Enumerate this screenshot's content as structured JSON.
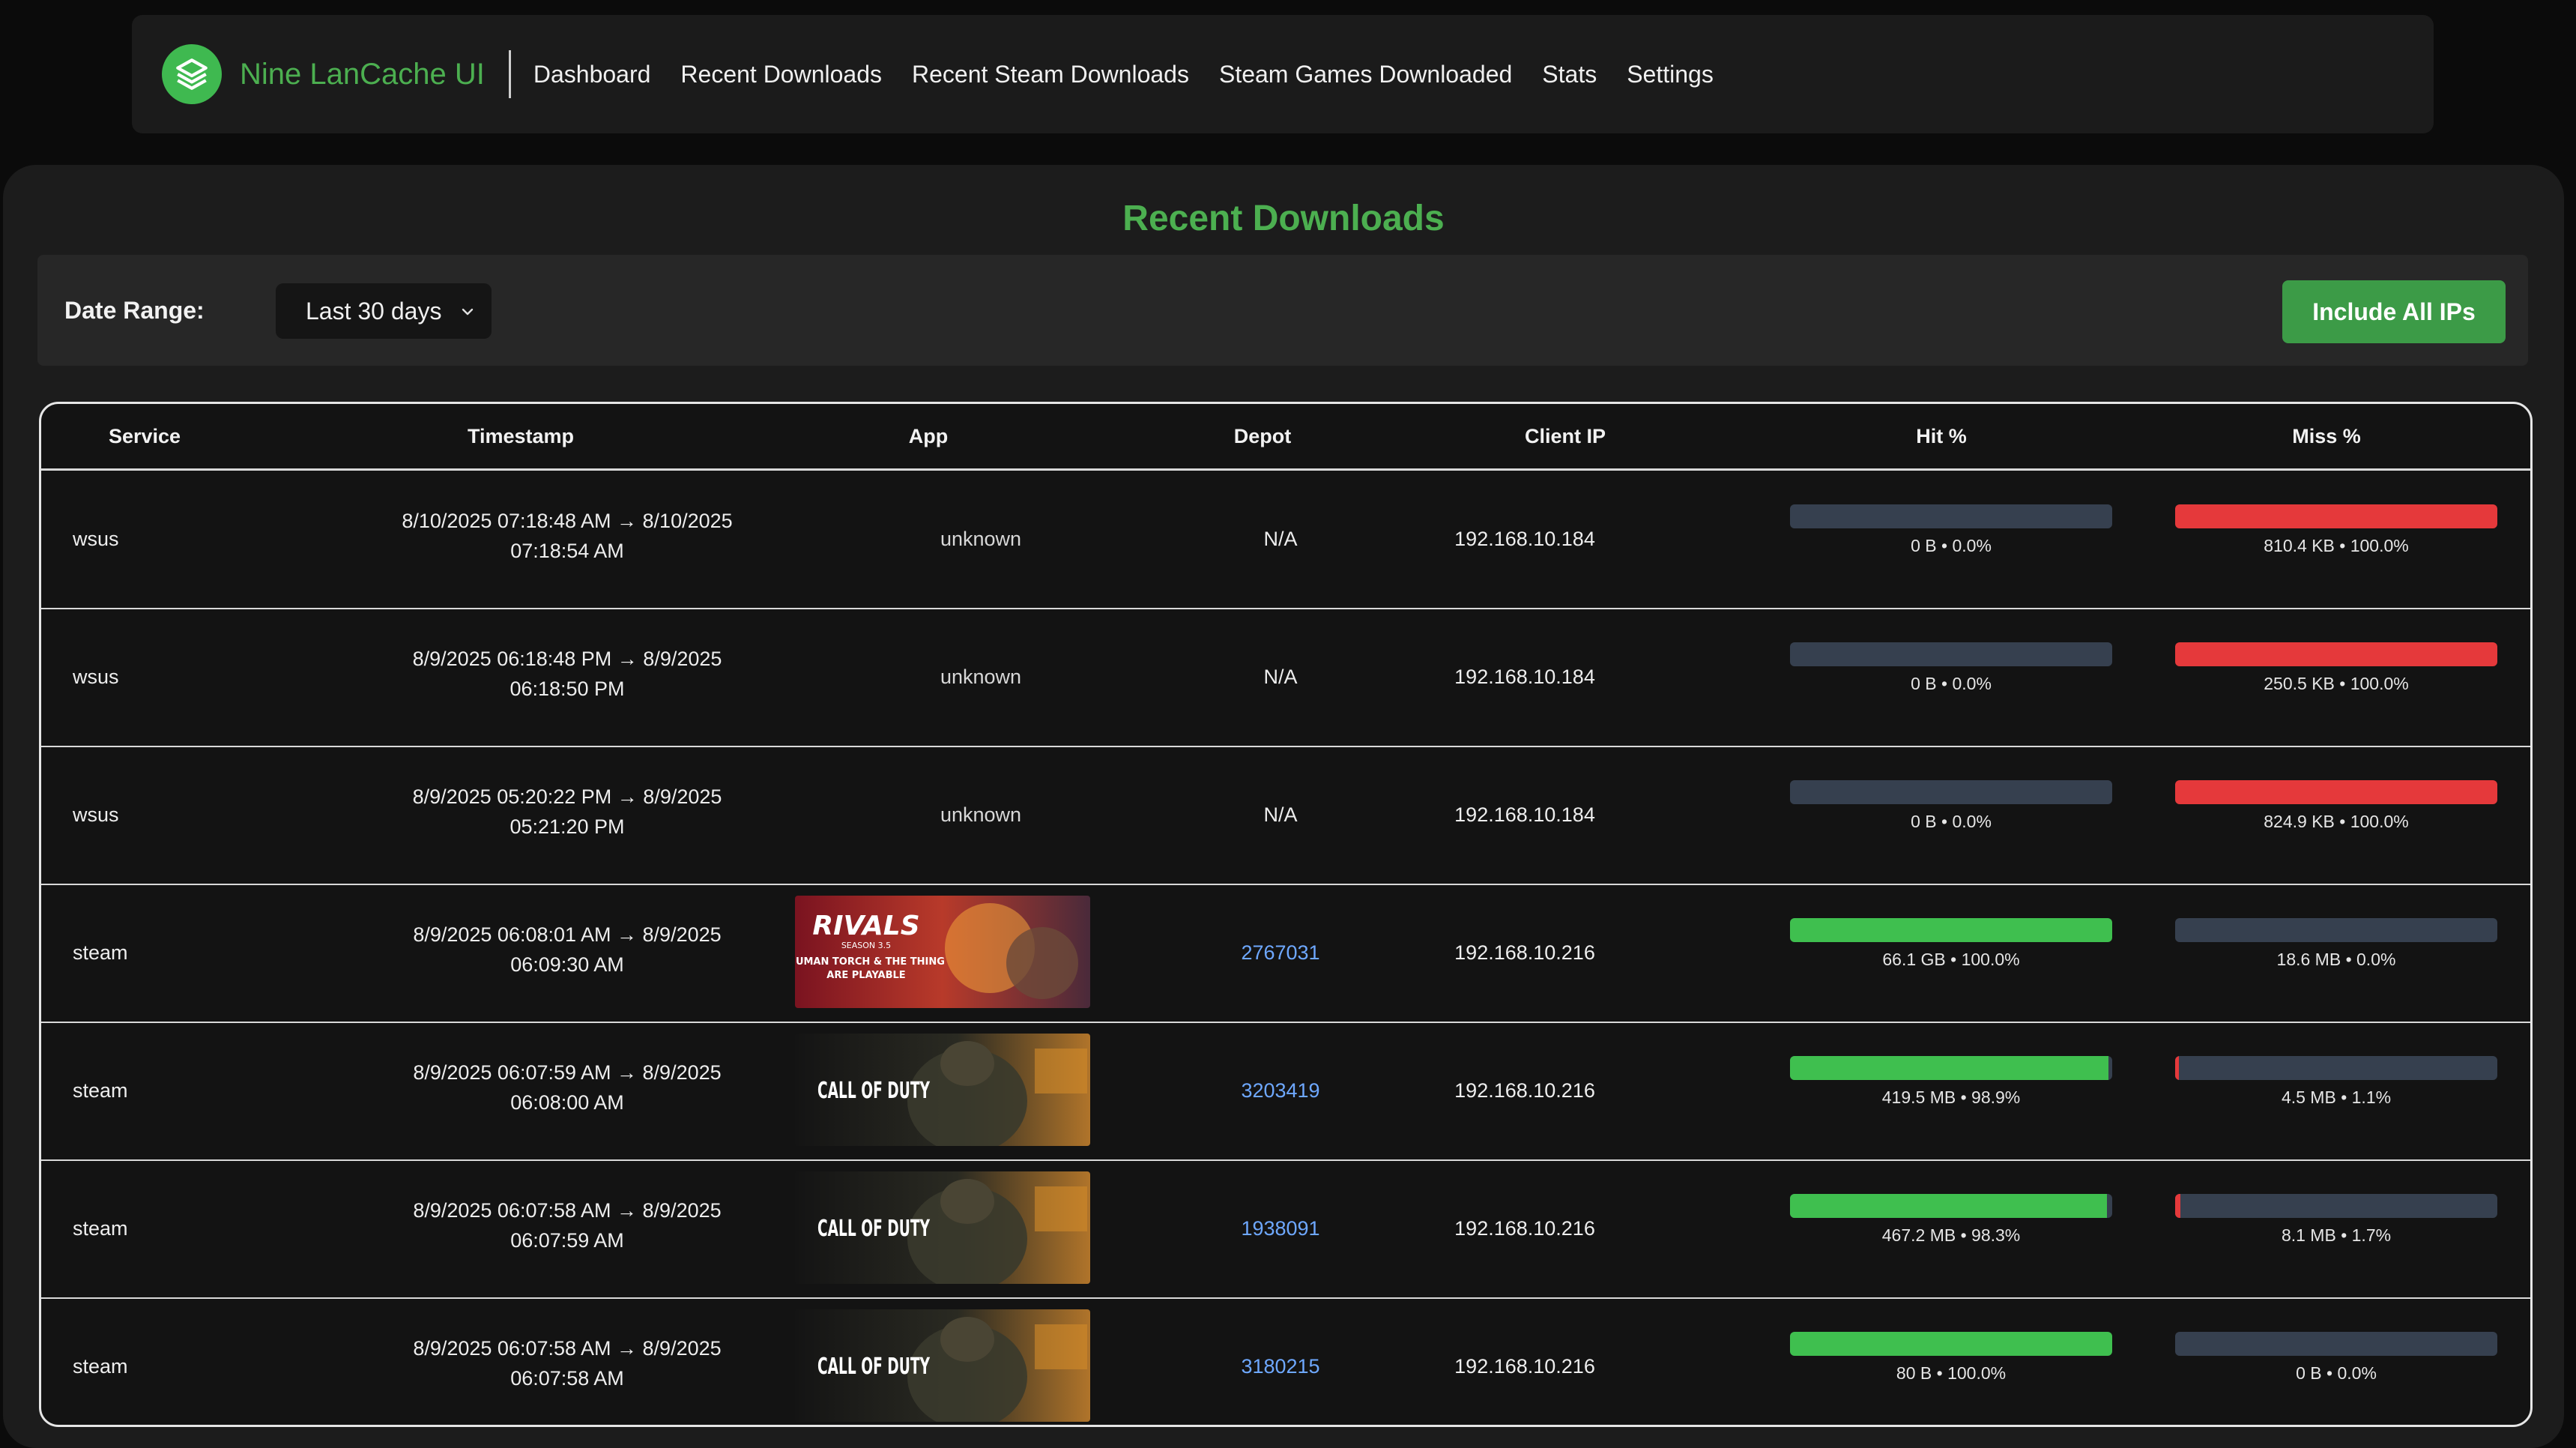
{
  "nav": {
    "brand": "Nine LanCache UI",
    "items": [
      "Dashboard",
      "Recent Downloads",
      "Recent Steam Downloads",
      "Steam Games Downloaded",
      "Stats",
      "Settings"
    ]
  },
  "page": {
    "title": "Recent Downloads",
    "date_range_label": "Date Range:",
    "date_range_value": "Last 30 days",
    "include_button": "Include All IPs"
  },
  "colors": {
    "accent": "#4caf50",
    "hit": "#3fbf4f",
    "miss": "#e5393b",
    "empty": "#36404f",
    "link": "#6ea8ff"
  },
  "table": {
    "headers": [
      "Service",
      "Timestamp",
      "App",
      "Depot",
      "Client IP",
      "Hit %",
      "Miss %"
    ],
    "rows": [
      {
        "service": "wsus",
        "ts1": "8/10/2025 07:18:48 AM → 8/10/2025",
        "ts2": "07:18:54 AM",
        "app": "unknown",
        "depot": "N/A",
        "ip": "192.168.10.184",
        "hit_label": "0 B • 0.0%",
        "hit_pct": 0.0,
        "miss_label": "810.4 KB • 100.0%",
        "miss_pct": 100.0
      },
      {
        "service": "wsus",
        "ts1": "8/9/2025 06:18:48 PM → 8/9/2025",
        "ts2": "06:18:50 PM",
        "app": "unknown",
        "depot": "N/A",
        "ip": "192.168.10.184",
        "hit_label": "0 B • 0.0%",
        "hit_pct": 0.0,
        "miss_label": "250.5 KB • 100.0%",
        "miss_pct": 100.0
      },
      {
        "service": "wsus",
        "ts1": "8/9/2025 05:20:22 PM → 8/9/2025",
        "ts2": "05:21:20 PM",
        "app": "unknown",
        "depot": "N/A",
        "ip": "192.168.10.184",
        "hit_label": "0 B • 0.0%",
        "hit_pct": 0.0,
        "miss_label": "824.9 KB • 100.0%",
        "miss_pct": 100.0
      },
      {
        "service": "steam",
        "ts1": "8/9/2025 06:08:01 AM → 8/9/2025",
        "ts2": "06:09:30 AM",
        "app_image": "rivals",
        "img_line1": "RIVALS",
        "img_line2": "SEASON 3.5",
        "img_line3": "HUMAN TORCH & THE THING",
        "img_line4": "ARE PLAYABLE",
        "depot": "2767031",
        "ip": "192.168.10.216",
        "hit_label": "66.1 GB • 100.0%",
        "hit_pct": 100.0,
        "miss_label": "18.6 MB • 0.0%",
        "miss_pct": 0.0
      },
      {
        "service": "steam",
        "ts1": "8/9/2025 06:07:59 AM → 8/9/2025",
        "ts2": "06:08:00 AM",
        "app_image": "cod",
        "img_line1": "CALL OF DUTY",
        "depot": "3203419",
        "ip": "192.168.10.216",
        "hit_label": "419.5 MB • 98.9%",
        "hit_pct": 98.9,
        "miss_label": "4.5 MB • 1.1%",
        "miss_pct": 1.1
      },
      {
        "service": "steam",
        "ts1": "8/9/2025 06:07:58 AM → 8/9/2025",
        "ts2": "06:07:59 AM",
        "app_image": "cod",
        "img_line1": "CALL OF DUTY",
        "depot": "1938091",
        "ip": "192.168.10.216",
        "hit_label": "467.2 MB • 98.3%",
        "hit_pct": 98.3,
        "miss_label": "8.1 MB • 1.7%",
        "miss_pct": 1.7
      },
      {
        "service": "steam",
        "ts1": "8/9/2025 06:07:58 AM → 8/9/2025",
        "ts2": "06:07:58 AM",
        "app_image": "cod",
        "img_line1": "CALL OF DUTY",
        "depot": "3180215",
        "ip": "192.168.10.216",
        "hit_label": "80 B • 100.0%",
        "hit_pct": 100.0,
        "miss_label": "0 B • 0.0%",
        "miss_pct": 0.0
      }
    ]
  }
}
